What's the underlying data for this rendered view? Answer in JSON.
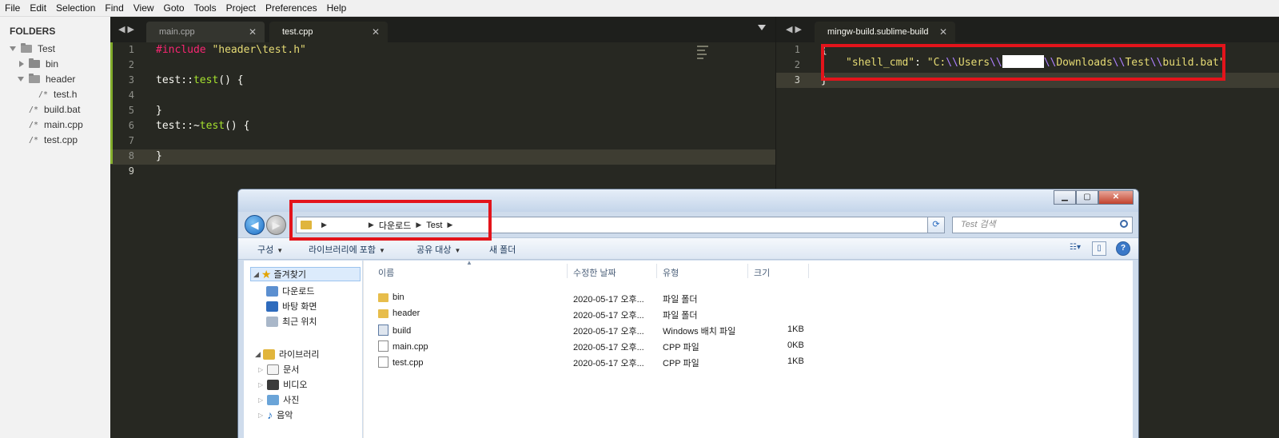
{
  "menu": [
    "File",
    "Edit",
    "Selection",
    "Find",
    "View",
    "Goto",
    "Tools",
    "Project",
    "Preferences",
    "Help"
  ],
  "sidebar": {
    "heading": "FOLDERS",
    "root": "Test",
    "bin": "bin",
    "header": "header",
    "header_file": "test.h",
    "files": [
      "build.bat",
      "main.cpp",
      "test.cpp"
    ],
    "file_icon": "/*"
  },
  "left_editor": {
    "tabs": [
      "main.cpp",
      "test.cpp"
    ],
    "active_tab": "test.cpp",
    "line_numbers": [
      "1",
      "2",
      "3",
      "4",
      "5",
      "6",
      "7",
      "8",
      "9"
    ],
    "code": {
      "l1_directive": "#include",
      "l1_string": "\"header\\test.h\"",
      "l3_class": "test::",
      "l3_fn": "test",
      "l3_rest": "() {",
      "l5": "}",
      "l6_class": "test::~",
      "l6_fn": "test",
      "l6_rest": "() {",
      "l8": "}"
    }
  },
  "right_editor": {
    "tab": "mingw-build.sublime-build",
    "line_numbers": [
      "1",
      "2",
      "3"
    ],
    "code": {
      "l1": "{",
      "key": "\"shell_cmd\"",
      "colon": ": ",
      "v_start": "\"C:",
      "esc": "\\\\",
      "v_users": "Users",
      "v_downloads": "Downloads",
      "v_test": "Test",
      "v_end": "build.bat\"",
      "l3": "}"
    }
  },
  "explorer": {
    "address": {
      "downloads": "다운로드",
      "test": "Test"
    },
    "search_placeholder": "Test 검색",
    "commands": {
      "organize": "구성",
      "include_library": "라이브러리에 포함",
      "share": "공유 대상",
      "new_folder": "새 폴더"
    },
    "nav": {
      "favorites": "즐겨찾기",
      "downloads": "다운로드",
      "desktop": "바탕 화면",
      "recent": "최근 위치",
      "libraries": "라이브러리",
      "documents": "문서",
      "videos": "비디오",
      "pictures": "사진",
      "music": "음악"
    },
    "columns": {
      "name": "이름",
      "modified": "수정한 날짜",
      "type": "유형",
      "size": "크기"
    },
    "files": [
      {
        "name": "bin",
        "modified": "2020-05-17 오후...",
        "type": "파일 폴더",
        "size": "",
        "icon": "folder-icon"
      },
      {
        "name": "header",
        "modified": "2020-05-17 오후...",
        "type": "파일 폴더",
        "size": "",
        "icon": "folder-icon"
      },
      {
        "name": "build",
        "modified": "2020-05-17 오후...",
        "type": "Windows 배치 파일",
        "size": "1KB",
        "icon": "batch-file-icon"
      },
      {
        "name": "main.cpp",
        "modified": "2020-05-17 오후...",
        "type": "CPP 파일",
        "size": "0KB",
        "icon": "document-icon"
      },
      {
        "name": "test.cpp",
        "modified": "2020-05-17 오후...",
        "type": "CPP 파일",
        "size": "1KB",
        "icon": "document-icon"
      }
    ]
  },
  "colors": {
    "editor_bg": "#272822",
    "highlight": "#e3141b",
    "keyword": "#f92672",
    "string": "#e6db74",
    "function": "#a6e22e"
  }
}
